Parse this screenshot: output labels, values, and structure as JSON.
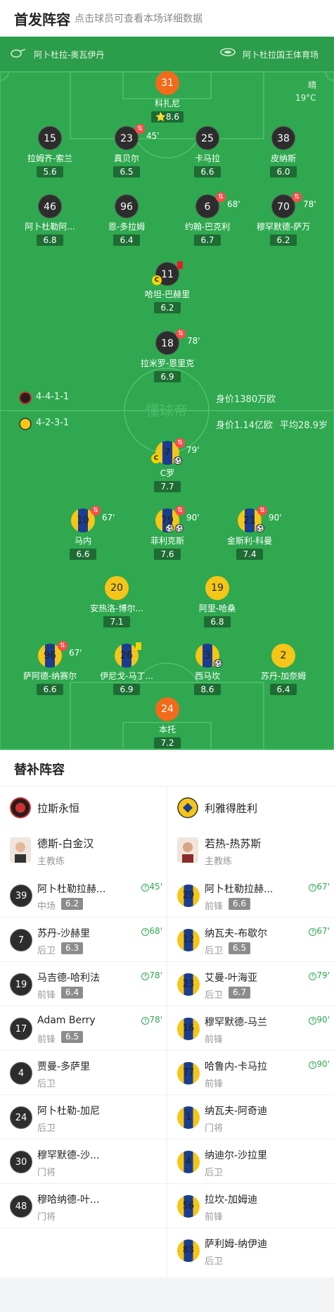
{
  "header": {
    "title": "首发阵容",
    "hint": "点击球员可查看本场详细数据"
  },
  "match": {
    "referee": "阿卜杜拉-奥瓦伊丹",
    "stadium": "阿卜杜拉国王体育场",
    "weather": "晴",
    "temperature": "19°C",
    "watermark": "懂球帝"
  },
  "home_team": {
    "formation": "4-4-1-1",
    "value_text": "身价1380万欧"
  },
  "away_team": {
    "formation": "4-2-3-1",
    "value_text": "身价1.14亿欧",
    "avg_age_text": "平均28.9岁"
  },
  "home_players": [
    {
      "num": "31",
      "name": "科扎尼",
      "rating": "8.6",
      "star": true
    },
    {
      "num": "15",
      "name": "拉姆齐-索兰",
      "rating": "5.6"
    },
    {
      "num": "23",
      "name": "真贝尔",
      "rating": "6.5",
      "sub": "45'"
    },
    {
      "num": "25",
      "name": "卡马拉",
      "rating": "6.6"
    },
    {
      "num": "38",
      "name": "皮纳斯",
      "rating": "6.0"
    },
    {
      "num": "46",
      "name": "阿卜杜勒阿...",
      "rating": "6.8"
    },
    {
      "num": "96",
      "name": "恩-多拉姆",
      "rating": "6.4"
    },
    {
      "num": "6",
      "name": "约翰-巴克利",
      "rating": "6.7",
      "sub": "68'"
    },
    {
      "num": "70",
      "name": "穆罕默德-萨万",
      "rating": "6.2",
      "sub": "78'"
    },
    {
      "num": "11",
      "name": "哈坦-巴赫里",
      "rating": "6.2",
      "captain": "C"
    },
    {
      "num": "18",
      "name": "拉米罗-恩里克",
      "rating": "6.9",
      "sub": "78'"
    }
  ],
  "away_players": [
    {
      "num": "7",
      "name": "C罗",
      "rating": "7.7",
      "sub": "79'",
      "captain": "C"
    },
    {
      "num": "10",
      "name": "马内",
      "rating": "6.6",
      "sub": "67'"
    },
    {
      "num": "79",
      "name": "菲利克斯",
      "rating": "7.6",
      "sub": "90'"
    },
    {
      "num": "21",
      "name": "金斯利-科曼",
      "rating": "7.4",
      "sub": "90'"
    },
    {
      "num": "20",
      "name": "安热洛-博尔...",
      "rating": "7.1"
    },
    {
      "num": "19",
      "name": "阿里-哈桑",
      "rating": "6.8"
    },
    {
      "num": "96",
      "name": "萨阿德-纳赛尔",
      "rating": "6.6",
      "sub": "67'"
    },
    {
      "num": "26",
      "name": "伊尼戈-马丁...",
      "rating": "6.9"
    },
    {
      "num": "3",
      "name": "西马坎",
      "rating": "8.6"
    },
    {
      "num": "2",
      "name": "苏丹-加奈姆",
      "rating": "6.4"
    },
    {
      "num": "24",
      "name": "本托",
      "rating": "7.2"
    }
  ],
  "subs": {
    "title": "替补阵容",
    "home": {
      "team": "拉斯永恒",
      "coach": {
        "name": "德斯-白金汉",
        "role": "主教练"
      },
      "players": [
        {
          "num": "39",
          "name": "阿卜杜勒拉赫...",
          "pos": "中场",
          "rating": "6.2",
          "in": "45'"
        },
        {
          "num": "7",
          "name": "苏丹-沙赫里",
          "pos": "后卫",
          "rating": "6.3",
          "in": "68'"
        },
        {
          "num": "19",
          "name": "马吉德-哈利法",
          "pos": "前锋",
          "rating": "6.4",
          "in": "78'"
        },
        {
          "num": "17",
          "name": "Adam Berry",
          "pos": "前锋",
          "rating": "6.5",
          "in": "78'"
        },
        {
          "num": "4",
          "name": "贾曼-多萨里",
          "pos": "后卫"
        },
        {
          "num": "24",
          "name": "阿卜杜勒-加尼",
          "pos": "后卫"
        },
        {
          "num": "30",
          "name": "穆罕默德-沙...",
          "pos": "门将"
        },
        {
          "num": "48",
          "name": "穆哈纳德-叶...",
          "pos": "门将"
        }
      ]
    },
    "away": {
      "team": "利雅得胜利",
      "coach": {
        "name": "若热-热苏斯",
        "role": "主教练"
      },
      "players": [
        {
          "num": "29",
          "name": "阿卜杜勒拉赫...",
          "pos": "前锋",
          "rating": "6.6",
          "in": "67'"
        },
        {
          "num": "12",
          "name": "纳瓦夫-布歇尔",
          "pos": "后卫",
          "rating": "6.5",
          "in": "67'"
        },
        {
          "num": "23",
          "name": "艾曼-叶海亚",
          "pos": "后卫",
          "rating": "6.7",
          "in": "79'"
        },
        {
          "num": "16",
          "name": "穆罕默德-马兰",
          "pos": "前锋",
          "in": "90'"
        },
        {
          "num": "77",
          "name": "哈鲁内-卡马拉",
          "pos": "前锋",
          "in": "90'"
        },
        {
          "num": "1",
          "name": "纳瓦夫-阿奇迪",
          "pos": "门将"
        },
        {
          "num": "4",
          "name": "纳迪尔-沙拉里",
          "pos": "后卫"
        },
        {
          "num": "56",
          "name": "拉坎-加姆迪",
          "pos": "前锋"
        },
        {
          "num": "83",
          "name": "萨利姆-纳伊迪",
          "pos": "后卫"
        }
      ]
    }
  },
  "colors": {
    "pitch": "#2fa84f",
    "home_num": "#2d2d2d",
    "away_num": "#f5c518",
    "accent": "#2fa84f"
  },
  "icons": {
    "referee": "whistle-icon",
    "stadium": "stadium-icon",
    "sub": "substitution-icon",
    "card": "card-icon",
    "goal": "ball-icon"
  }
}
